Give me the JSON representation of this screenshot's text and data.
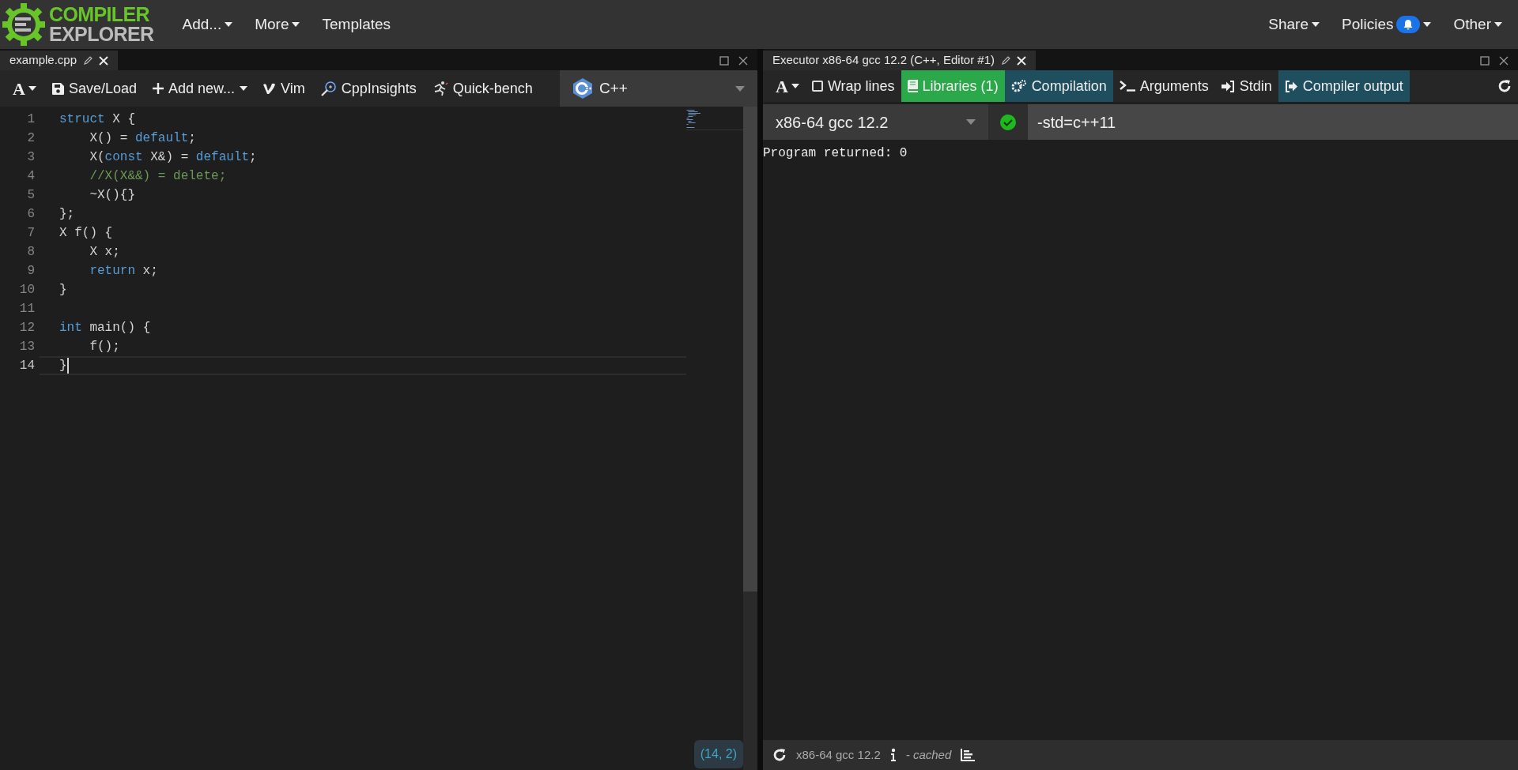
{
  "navbar": {
    "logo": {
      "line_1": "COMPILER",
      "line_2": "EXPLORER"
    },
    "left_menu": [
      {
        "label": "Add...",
        "dropdown": true
      },
      {
        "label": "More",
        "dropdown": true
      },
      {
        "label": "Templates",
        "dropdown": false
      }
    ],
    "right_menu": [
      {
        "label": "Share",
        "dropdown": true,
        "notification": false
      },
      {
        "label": "Policies",
        "dropdown": true,
        "notification": true
      },
      {
        "label": "Other",
        "dropdown": true,
        "notification": false
      }
    ]
  },
  "editor_pane": {
    "tab": {
      "title": "example.cpp"
    },
    "toolbar": [
      {
        "kind": "font",
        "label": "A"
      },
      {
        "kind": "save",
        "label": "Save/Load"
      },
      {
        "kind": "add",
        "label": "Add new..."
      },
      {
        "kind": "vim",
        "label": "Vim"
      },
      {
        "kind": "insights",
        "label": "CppInsights"
      },
      {
        "kind": "bench",
        "label": "Quick-bench"
      }
    ],
    "language": "C++",
    "lines": [
      {
        "number": "1",
        "current": false,
        "tokens": [
          {
            "kind": "keyword",
            "text": "struct"
          },
          {
            "kind": "plain",
            "text": " X {"
          }
        ]
      },
      {
        "number": "2",
        "current": false,
        "tokens": [
          {
            "kind": "plain",
            "text": "    X() = "
          },
          {
            "kind": "keyword",
            "text": "default"
          },
          {
            "kind": "plain",
            "text": ";"
          }
        ]
      },
      {
        "number": "3",
        "current": false,
        "tokens": [
          {
            "kind": "plain",
            "text": "    X("
          },
          {
            "kind": "keyword",
            "text": "const"
          },
          {
            "kind": "plain",
            "text": " X&) = "
          },
          {
            "kind": "keyword",
            "text": "default"
          },
          {
            "kind": "plain",
            "text": ";"
          }
        ]
      },
      {
        "number": "4",
        "current": false,
        "tokens": [
          {
            "kind": "comment",
            "text": "    //X(X&&) = delete;"
          }
        ]
      },
      {
        "number": "5",
        "current": false,
        "tokens": [
          {
            "kind": "plain",
            "text": "    ~X(){}"
          }
        ]
      },
      {
        "number": "6",
        "current": false,
        "tokens": [
          {
            "kind": "plain",
            "text": "};"
          }
        ]
      },
      {
        "number": "7",
        "current": false,
        "tokens": [
          {
            "kind": "plain",
            "text": "X f() {"
          }
        ]
      },
      {
        "number": "8",
        "current": false,
        "tokens": [
          {
            "kind": "plain",
            "text": "    X x;"
          }
        ]
      },
      {
        "number": "9",
        "current": false,
        "tokens": [
          {
            "kind": "keyword",
            "text": "    return"
          },
          {
            "kind": "plain",
            "text": " x;"
          }
        ]
      },
      {
        "number": "10",
        "current": false,
        "tokens": [
          {
            "kind": "plain",
            "text": "}"
          }
        ]
      },
      {
        "number": "11",
        "current": false
      },
      {
        "number": "12",
        "current": false,
        "tokens": [
          {
            "kind": "keyword",
            "text": "int"
          },
          {
            "kind": "plain",
            "text": " main() {"
          }
        ]
      },
      {
        "number": "13",
        "current": false,
        "tokens": [
          {
            "kind": "plain",
            "text": "    f();"
          }
        ]
      },
      {
        "number": "14",
        "current": true,
        "tokens": [
          {
            "kind": "plain",
            "text": "}"
          }
        ]
      }
    ],
    "cursor_position": "(14, 2)"
  },
  "executor_pane": {
    "tab": {
      "title": "Executor x86-64 gcc 12.2 (C++, Editor #1)"
    },
    "toolbar": [
      {
        "kind": "font",
        "label": "A"
      },
      {
        "kind": "checkbox",
        "label": "Wrap lines",
        "checked": false
      },
      {
        "kind": "libraries",
        "label": "Libraries (1)"
      },
      {
        "kind": "compilation",
        "label": "Compilation",
        "selected": true
      },
      {
        "kind": "arguments",
        "label": "Arguments",
        "selected": false
      },
      {
        "kind": "stdin",
        "label": "Stdin",
        "selected": false
      },
      {
        "kind": "output",
        "label": "Compiler output",
        "selected": true
      }
    ],
    "compiler": "x86-64 gcc 12.2",
    "compile_ok": true,
    "options": "-std=c++11",
    "output": "Program returned: 0",
    "status_bar": {
      "compiler": "x86-64 gcc 12.2",
      "cache": "- cached"
    }
  }
}
